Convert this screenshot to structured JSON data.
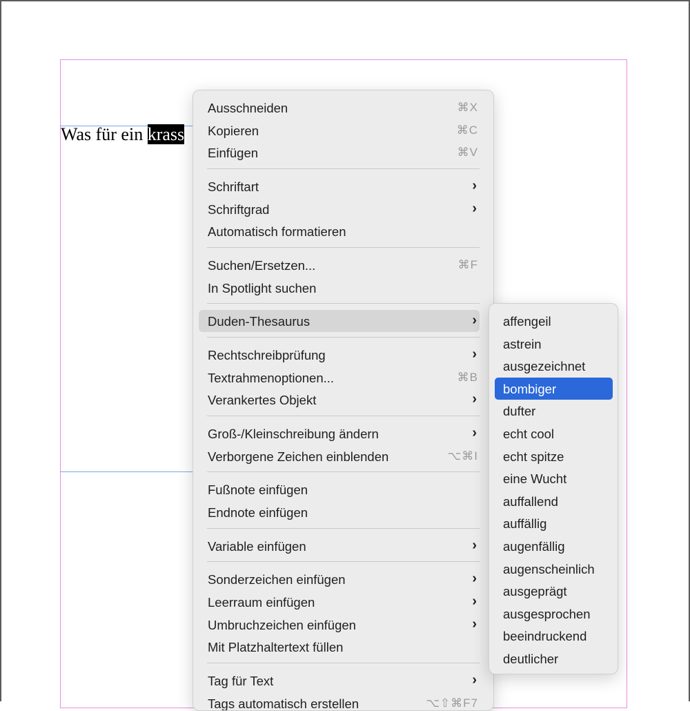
{
  "document": {
    "text_before": "Was für ein ",
    "text_selected": "krass"
  },
  "menu": {
    "items": [
      {
        "label": "Ausschneiden",
        "shortcut": "⌘X"
      },
      {
        "label": "Kopieren",
        "shortcut": "⌘C"
      },
      {
        "label": "Einfügen",
        "shortcut": "⌘V"
      },
      {
        "label": "Schriftart",
        "submenu": true
      },
      {
        "label": "Schriftgrad",
        "submenu": true
      },
      {
        "label": "Automatisch formatieren"
      },
      {
        "label": "Suchen/Ersetzen...",
        "shortcut": "⌘F"
      },
      {
        "label": "In Spotlight suchen"
      },
      {
        "label": "Duden-Thesaurus",
        "submenu": true,
        "highlighted": true
      },
      {
        "label": "Rechtschreibprüfung",
        "submenu": true
      },
      {
        "label": "Textrahmenoptionen...",
        "shortcut": "⌘B"
      },
      {
        "label": "Verankertes Objekt",
        "submenu": true
      },
      {
        "label": "Groß-/Kleinschreibung ändern",
        "submenu": true
      },
      {
        "label": "Verborgene Zeichen einblenden",
        "shortcut": "⌥⌘I"
      },
      {
        "label": "Fußnote einfügen"
      },
      {
        "label": "Endnote einfügen"
      },
      {
        "label": "Variable einfügen",
        "submenu": true
      },
      {
        "label": "Sonderzeichen einfügen",
        "submenu": true
      },
      {
        "label": "Leerraum einfügen",
        "submenu": true
      },
      {
        "label": "Umbruchzeichen einfügen",
        "submenu": true
      },
      {
        "label": "Mit Platzhaltertext füllen"
      },
      {
        "label": "Tag für Text",
        "submenu": true
      },
      {
        "label": "Tags automatisch erstellen",
        "shortcut": "⌥⇧⌘F7"
      }
    ]
  },
  "submenu": {
    "items": [
      "affengeil",
      "astrein",
      "ausgezeichnet",
      "bombiger",
      "dufter",
      "echt cool",
      "echt spitze",
      "eine Wucht",
      "auffallend",
      "auffällig",
      "augenfällig",
      "augenscheinlich",
      "ausgeprägt",
      "ausgesprochen",
      "beeindruckend",
      "deutlicher"
    ],
    "selected": "bombiger"
  },
  "icons": {
    "submenu_arrow": "chevron-right-icon"
  },
  "colors": {
    "selection_blue": "#2b68d9",
    "margin_guide": "#e88ce8",
    "frame_guide": "#7aa7e8"
  }
}
